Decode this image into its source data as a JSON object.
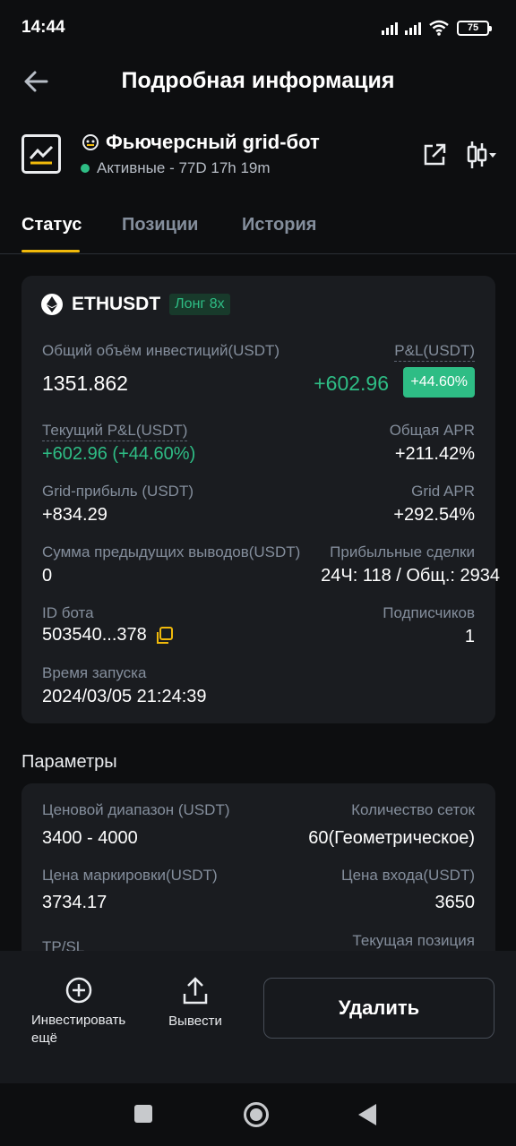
{
  "status_bar": {
    "time": "14:44",
    "battery": "75"
  },
  "header": {
    "title": "Подробная информация"
  },
  "bot": {
    "name": "Фьючерсный grid-бот",
    "status": "Активные - 77D 17h 19m"
  },
  "tabs": [
    {
      "label": "Статус",
      "active": true
    },
    {
      "label": "Позиции",
      "active": false
    },
    {
      "label": "История",
      "active": false
    }
  ],
  "summary": {
    "pair": "ETHUSDT",
    "leverage_badge": "Лонг 8x",
    "total_investment_label": "Общий объём инвестиций(USDT)",
    "total_investment_value": "1351.862",
    "pnl_label": "P&L(USDT)",
    "pnl_value": "+602.96",
    "pnl_pct": "+44.60%",
    "current_pnl_label": "Текущий P&L(USDT)",
    "current_pnl_value": "+602.96 (+44.60%)",
    "total_apr_label": "Общая APR",
    "total_apr_value": "+211.42%",
    "grid_profit_label": "Grid-прибыль (USDT)",
    "grid_profit_value": "+834.29",
    "grid_apr_label": "Grid APR",
    "grid_apr_value": "+292.54%",
    "prev_withdrawals_label": "Сумма предыдущих выводов(USDT)",
    "prev_withdrawals_value": "0",
    "profitable_trades_label": "Прибыльные сделки",
    "profitable_trades_value": "24Ч: 118 / Общ.: 2934",
    "bot_id_label": "ID бота",
    "bot_id_value": "503540...378",
    "subscribers_label": "Подписчиков",
    "subscribers_value": "1",
    "launch_time_label": "Время запуска",
    "launch_time_value": "2024/03/05 21:24:39"
  },
  "params": {
    "section_title": "Параметры",
    "price_range_label": "Ценовой диапазон (USDT)",
    "price_range_value": "3400 - 4000",
    "grid_count_label": "Количество сеток",
    "grid_count_value": "60(Геометрическое)",
    "mark_price_label": "Цена маркировки(USDT)",
    "mark_price_value": "3734.17",
    "entry_price_label": "Цена входа(USDT)",
    "entry_price_value": "3650",
    "tpsl_label": "TP/SL",
    "current_position_label": "Текущая позиция"
  },
  "actions": {
    "invest_more": "Инвестировать ещё",
    "withdraw": "Вывести",
    "delete": "Удалить"
  },
  "colors": {
    "positive": "#2ebd85",
    "accent": "#f0b90b",
    "background": "#0d0e10",
    "card": "#1a1c20"
  }
}
